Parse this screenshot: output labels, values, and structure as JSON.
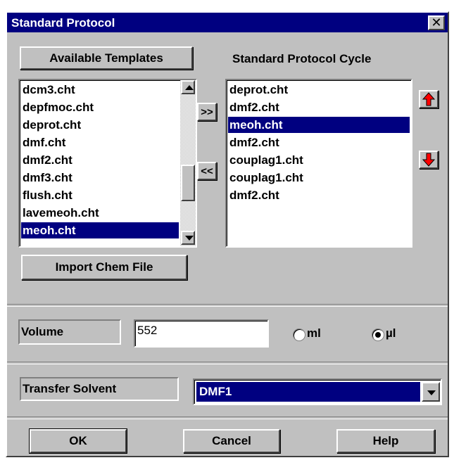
{
  "window": {
    "title": "Standard Protocol",
    "close_glyph": "✕"
  },
  "templates": {
    "button_label": "Available Templates",
    "items": [
      "dcm3.cht",
      "depfmoc.cht",
      "deprot.cht",
      "dmf.cht",
      "dmf2.cht",
      "dmf3.cht",
      "flush.cht",
      "lavemeoh.cht",
      "meoh.cht"
    ],
    "selected": "meoh.cht"
  },
  "cycle": {
    "label": "Standard Protocol Cycle",
    "items": [
      "deprot.cht",
      "dmf2.cht",
      "meoh.cht",
      "dmf2.cht",
      "couplag1.cht",
      "couplag1.cht",
      "dmf2.cht"
    ],
    "selected": "meoh.cht"
  },
  "transfer": {
    "add_label": ">>",
    "remove_label": "<<"
  },
  "import_label": "Import Chem File",
  "volume": {
    "label": "Volume",
    "value": "552",
    "unit_ml": "ml",
    "unit_ul": "µl",
    "selected_unit": "µl"
  },
  "solvent": {
    "label": "Transfer Solvent",
    "value": "DMF1"
  },
  "buttons": {
    "ok": "OK",
    "cancel": "Cancel",
    "help": "Help"
  },
  "colors": {
    "selection": "#000080",
    "move_arrow": "#ff0000",
    "face": "#c0c0c0"
  }
}
